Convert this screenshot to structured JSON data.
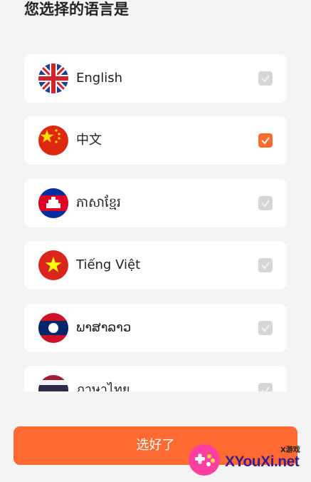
{
  "page": {
    "title": "您选择的语言是"
  },
  "languages": [
    {
      "label": "English",
      "flag_icon": "uk-flag-icon",
      "checked": false
    },
    {
      "label": "中文",
      "flag_icon": "china-flag-icon",
      "checked": true
    },
    {
      "label": "ភាសាខ្មែរ",
      "flag_icon": "cambodia-flag-icon",
      "checked": false
    },
    {
      "label": "Tiếng Việt",
      "flag_icon": "vietnam-flag-icon",
      "checked": false
    },
    {
      "label": "ພາສາລາວ",
      "flag_icon": "laos-flag-icon",
      "checked": false
    },
    {
      "label": "ภาษาไทย",
      "flag_icon": "thailand-flag-icon",
      "checked": false
    }
  ],
  "confirm_button": {
    "label": "选好了"
  },
  "watermark": {
    "site": "XYouXi.net",
    "tag": "X游戏"
  },
  "colors": {
    "accent": "#ff6a32",
    "checked": "#ff6a2e",
    "unchecked": "#d6d6d6",
    "background": "#f4f4f4"
  }
}
